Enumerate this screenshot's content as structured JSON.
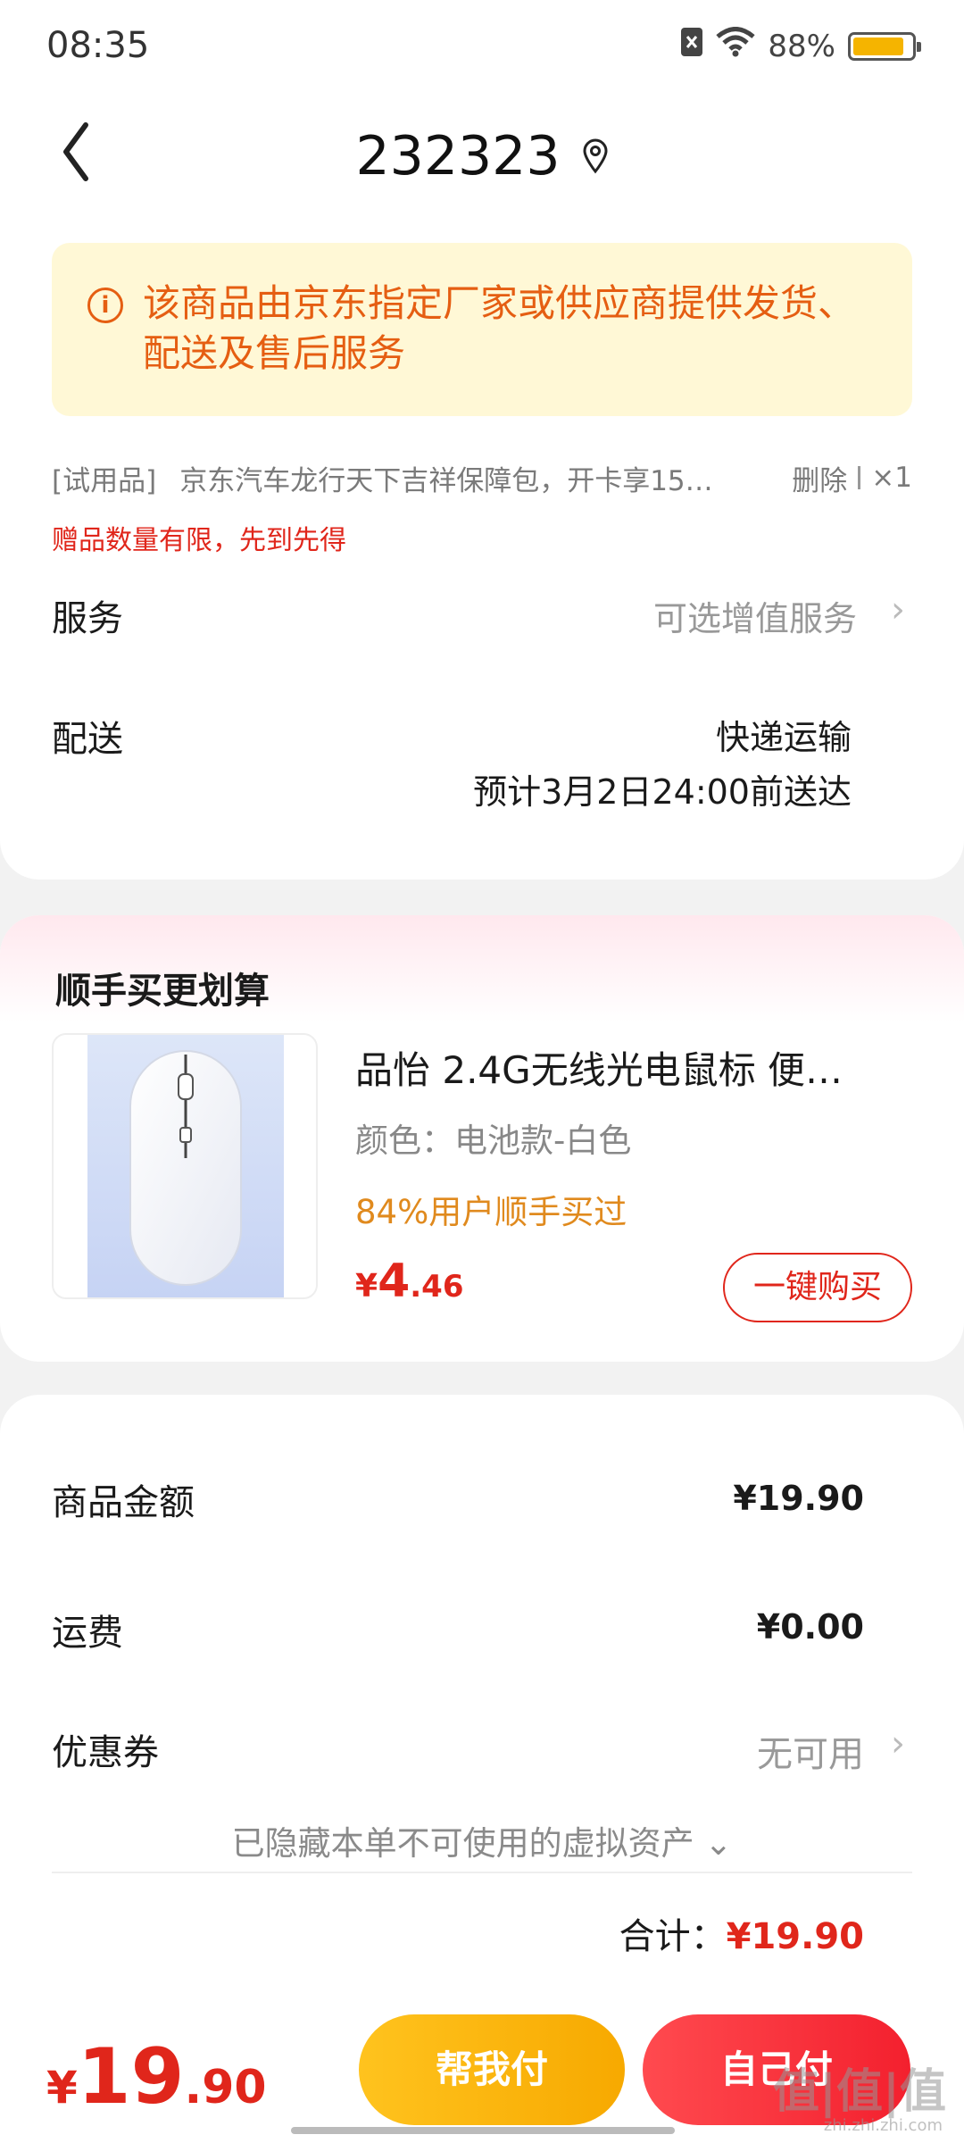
{
  "status_bar": {
    "time": "08:35",
    "battery": "88%",
    "battery_level": 0.88
  },
  "header": {
    "title": "232323",
    "location_icon": "location-pin-icon",
    "back_icon": "chevron-left-icon"
  },
  "notice": {
    "text": "该商品由京东指定厂家或供应商提供发货、配送及售后服务",
    "icon": "info-icon"
  },
  "gift": {
    "tag": "[试用品]",
    "name": "京东汽车龙行天下吉祥保障包，开卡享15…",
    "delete_label": "删除",
    "quantity": "×1",
    "note": "赠品数量有限，先到先得"
  },
  "service": {
    "label": "服务",
    "value": "可选增值服务"
  },
  "delivery": {
    "label": "配送",
    "method": "快递运输",
    "eta": "预计3月2日24:00前送达"
  },
  "recommend": {
    "title": "顺手买更划算",
    "product_name": "品怡 2.4G无线光电鼠标 便…",
    "color": "颜色：电池款-白色",
    "rate": "84%用户顺手买过",
    "price_symbol": "¥",
    "price_int": "4",
    "price_dec": ".46",
    "buy_label": "一键购买"
  },
  "amounts": {
    "goods_label": "商品金额",
    "goods_value": "¥19.90",
    "shipping_label": "运费",
    "shipping_value": "¥0.00",
    "coupon_label": "优惠券",
    "coupon_value": "无可用",
    "hidden_assets": "已隐藏本单不可使用的虚拟资产",
    "total_label": "合计：",
    "total_value": "¥19.90"
  },
  "bottom": {
    "price_symbol": "¥",
    "price_int": "19",
    "price_dec": ".90",
    "help_pay_label": "帮我付",
    "self_pay_label": "自己付"
  },
  "watermark": {
    "text": "值|值|值",
    "sub": "zhi.zhi.zhi.com"
  },
  "colors": {
    "accent_red": "#e0261b",
    "accent_orange": "#e55e12",
    "accent_yellow": "#f7a900"
  }
}
